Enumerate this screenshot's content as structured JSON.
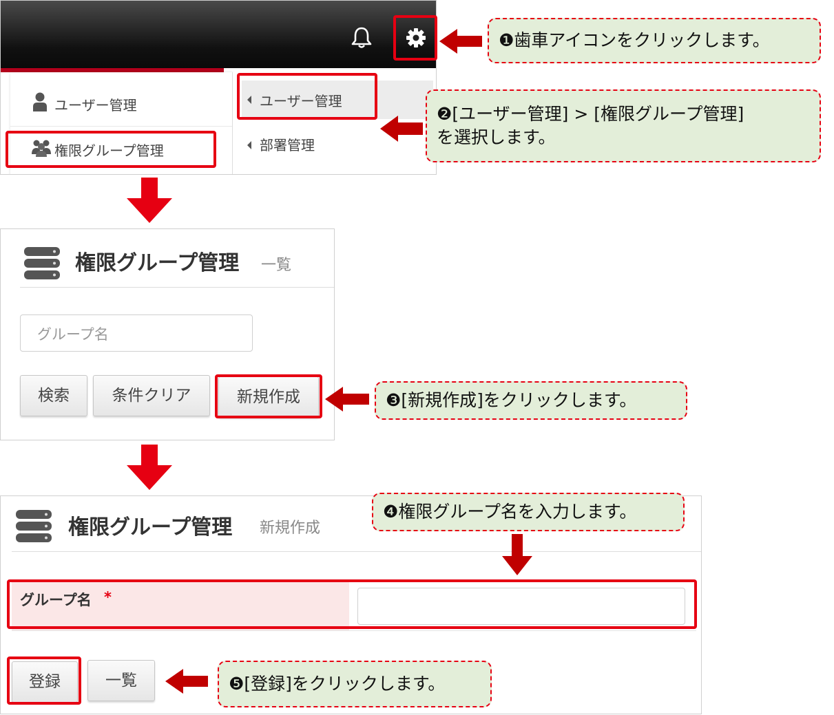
{
  "header": {
    "bell_icon": "bell-icon",
    "gear_icon": "gear-icon"
  },
  "menu": {
    "main_items": [
      {
        "label": "ユーザー管理",
        "icon": "user-icon"
      },
      {
        "label": "権限グループ管理",
        "icon": "group-icon"
      }
    ],
    "sub_items": [
      {
        "label": "ユーザー管理"
      },
      {
        "label": "部署管理"
      }
    ]
  },
  "list_page": {
    "title": "権限グループ管理",
    "subtitle": "一覧",
    "search_placeholder": "グループ名",
    "buttons": {
      "search": "検索",
      "clear": "条件クリア",
      "create": "新規作成"
    }
  },
  "create_page": {
    "title": "権限グループ管理",
    "subtitle": "新規作成",
    "field_label": "グループ名",
    "required_mark": "*",
    "field_value": "",
    "buttons": {
      "register": "登録",
      "list": "一覧"
    }
  },
  "callouts": {
    "step1": "❶歯車アイコンをクリックします。",
    "step2_line1": "❷[ユーザー管理] > [権限グループ管理]",
    "step2_line2": "を選択します。",
    "step3": "❸[新規作成]をクリックします。",
    "step4": "❹権限グループ名を入力します。",
    "step5": "❺[登録]をクリックします。"
  },
  "colors": {
    "annotation_red": "#e60012",
    "arrow_red": "#c00000",
    "callout_bg": "#e3eed9",
    "header_black": "#111111",
    "required_bg": "#fbe7e7"
  }
}
